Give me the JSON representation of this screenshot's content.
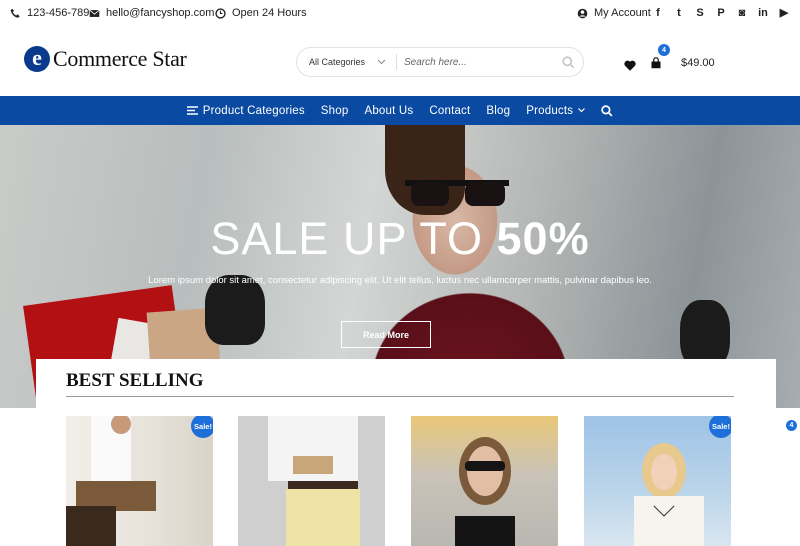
{
  "topbar": {
    "phone": "123-456-789",
    "email": "hello@fancyshop.com",
    "hours": "Open 24 Hours",
    "account": "My Account",
    "social_icons": [
      "facebook-icon",
      "twitter-icon",
      "skype-icon",
      "pinterest-icon",
      "instagram-icon",
      "linkedin-icon",
      "youtube-icon"
    ]
  },
  "header": {
    "logo_letter": "e",
    "logo_text": "Commerce Star",
    "category_select": "All Categories",
    "search_placeholder": "Search here...",
    "cart_count": "4",
    "cart_total": "$49.00"
  },
  "nav": {
    "items": [
      "Product Categories",
      "Shop",
      "About Us",
      "Contact",
      "Blog",
      "Products"
    ]
  },
  "hero": {
    "title_light": "SALE UP TO ",
    "title_bold": "50%",
    "description": "Lorem ipsum dolor sit amet, consectetur adipiscing elit. Ut elit tellus, luctus nec ullamcorper mattis, pulvinar dapibus leo.",
    "button": "Read More"
  },
  "best_selling": {
    "title": "BEST SELLING",
    "products": [
      {
        "sale": "Sale!",
        "image": "man-sitting"
      },
      {
        "sale": "",
        "image": "man-reading"
      },
      {
        "sale": "",
        "image": "woman-sunglasses"
      },
      {
        "sale": "Sale!",
        "image": "woman-blonde"
      }
    ]
  },
  "floating_badge": "4",
  "colors": {
    "brand_blue": "#0b4aa2",
    "accent_blue": "#1e6fd9"
  }
}
